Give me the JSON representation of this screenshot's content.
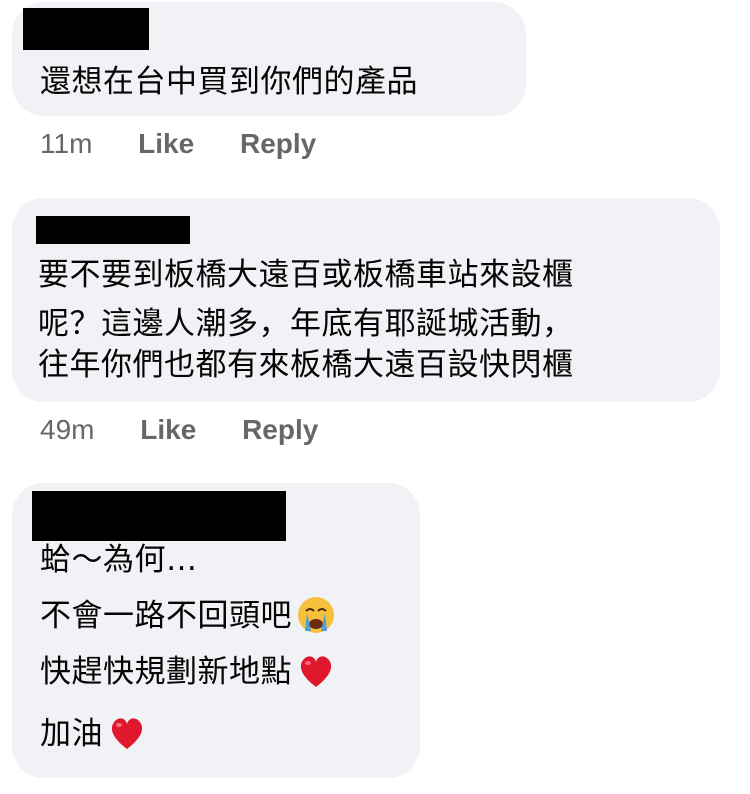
{
  "comments": [
    {
      "lines": [
        "還想在台中買到你們的產品"
      ],
      "time": "11m",
      "like_label": "Like",
      "reply_label": "Reply"
    },
    {
      "lines": [
        "要不要到板橋大遠百或板橋車站來設櫃",
        "呢？這邊人潮多，年底有耶誕城活動，",
        "往年你們也都有來板橋大遠百設快閃櫃"
      ],
      "time": "49m",
      "like_label": "Like",
      "reply_label": "Reply"
    },
    {
      "lines": [
        "蛤～為何…",
        "不會一路不回頭吧",
        "快趕快規劃新地點",
        "加油"
      ],
      "line_emojis": [
        "",
        "crying-face-emoji",
        "red-heart-emoji",
        "red-heart-emoji"
      ]
    }
  ],
  "colors": {
    "bubble": "#f0f2f5",
    "meta": "#65676b",
    "text": "#050505",
    "heart": "#e0182d",
    "emoji_face": "#f7c03a",
    "tears": "#4aa3df"
  }
}
